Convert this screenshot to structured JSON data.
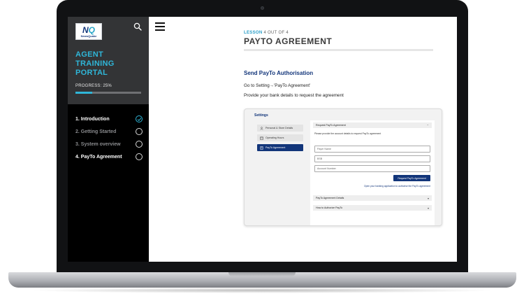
{
  "brand": {
    "logo_mark_a": "N",
    "logo_mark_b": "Q",
    "logo_text": "NewsQuake"
  },
  "sidebar": {
    "title_lines": [
      "AGENT",
      "TRAINING",
      "PORTAL"
    ],
    "progress_label": "PROGRESS: 25%",
    "progress_percent": 25,
    "lessons": [
      {
        "label": "1. Introduction",
        "status": "completed"
      },
      {
        "label": "2. Getting Started",
        "status": "locked"
      },
      {
        "label": "3. System overview",
        "status": "locked"
      },
      {
        "label": "4. PayTo Agreement",
        "status": "current"
      }
    ]
  },
  "lesson": {
    "tag_prefix": "LESSON",
    "tag_suffix": "4 OUT OF 4",
    "title": "PAYTO AGREEMENT",
    "section_heading": "Send PayTo Authorisation",
    "instruction_1": "Go to Setting→'PayTo Agreement'",
    "instruction_2": "Provide your bank details to request the agreement"
  },
  "settings_screenshot": {
    "title": "Settings",
    "nav": [
      {
        "label": "Personal & Store Details",
        "icon": "user-icon",
        "active": false
      },
      {
        "label": "Operating Hours",
        "icon": "calendar-icon",
        "active": false
      },
      {
        "label": "PayTo Agreement",
        "icon": "document-icon",
        "active": true
      }
    ],
    "request_section": "Request PayTo Agreement",
    "hint": "Please provide the account details to request PayTo agreement",
    "placeholders": [
      "Payer Name",
      "BSB",
      "Account Number"
    ],
    "button": "Request PayTo Agreement",
    "note": "Open your banking application to authorise the PayTo agreement",
    "collapsed_sections": [
      "PayTo Agreement Details",
      "How to Authorize PayTo"
    ]
  },
  "colors": {
    "accent": "#2fb6d8",
    "brand_navy": "#12357a",
    "sidebar_bg": "#000000",
    "sidebar_header_bg": "#333436"
  }
}
